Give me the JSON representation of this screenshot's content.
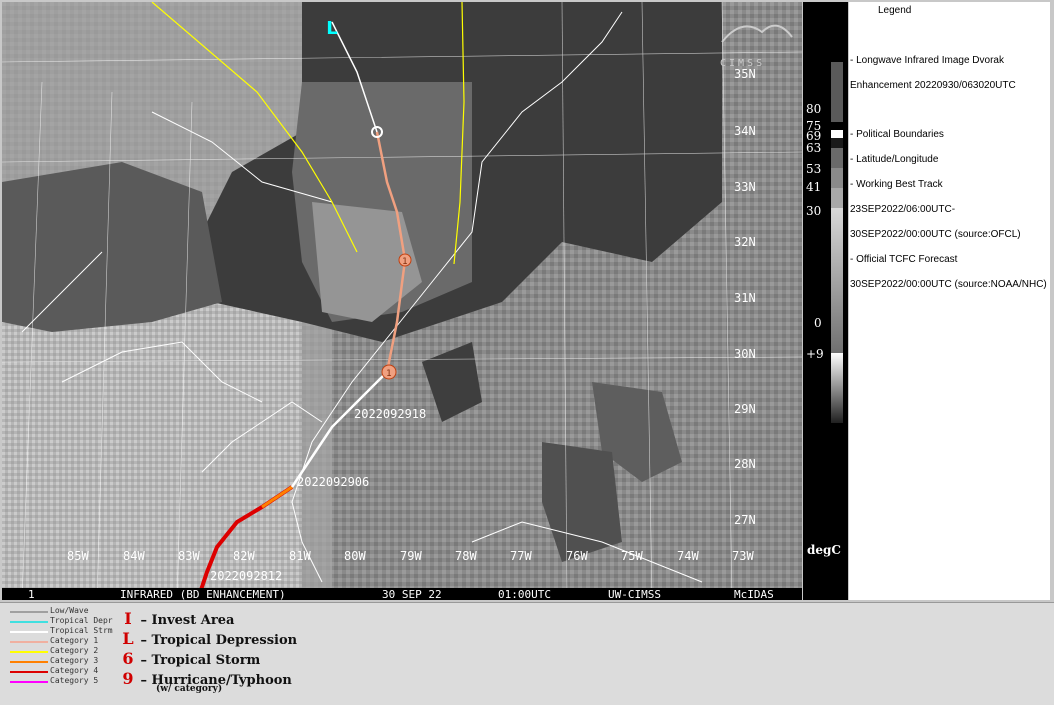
{
  "map": {
    "lon_labels": [
      "85W",
      "84W",
      "83W",
      "82W",
      "81W",
      "80W",
      "79W",
      "78W",
      "77W",
      "76W",
      "75W",
      "74W",
      "73W"
    ],
    "lat_labels": [
      "35N",
      "34N",
      "33N",
      "32N",
      "31N",
      "30N",
      "29N",
      "28N",
      "27N"
    ],
    "track_labels": [
      "2022092918",
      "2022092906",
      "2022092812"
    ],
    "forecast_markers": [
      "1",
      "1"
    ],
    "storm_markers": [
      "L"
    ],
    "status_bar": {
      "frame": "1",
      "product": "INFRARED (BD ENHANCEMENT)",
      "date": "30 SEP 22",
      "time": "01:00UTC",
      "source": "UW-CIMSS",
      "software": "McIDAS"
    },
    "logo": "CIMSS",
    "colors": {
      "observed_track": "#ffffff",
      "forecast_track": "#f0a080",
      "cone": "#ffff00",
      "category3": "#ff8000",
      "category4": "#cc0000",
      "depression_marker": "#00ffff"
    }
  },
  "colorbar": {
    "labels": [
      "80",
      "75",
      "69",
      "63",
      "53",
      "41",
      "30",
      "0",
      "+9"
    ],
    "unit": "degC"
  },
  "legend": {
    "title": "Legend",
    "lines": [
      "-  Longwave Infrared Image  Dvorak",
      "Enhancement  20220930/063020UTC",
      "-  Political Boundaries",
      "-  Latitude/Longitude",
      "-  Working Best Track",
      "23SEP2022/06:00UTC-",
      "30SEP2022/00:00UTC   (source:OFCL)",
      "-  Official TCFC Forecast",
      "30SEP2022/00:00UTC  (source:NOAA/NHC)"
    ]
  },
  "track_legend": {
    "categories": [
      {
        "label": "Low/Wave",
        "color": "#a0a0a0"
      },
      {
        "label": "Tropical Depr",
        "color": "#40e0e0"
      },
      {
        "label": "Tropical Strm",
        "color": "#ffffff"
      },
      {
        "label": "Category 1",
        "color": "#f0b0a0"
      },
      {
        "label": "Category 2",
        "color": "#ffff00"
      },
      {
        "label": "Category 3",
        "color": "#ff8000"
      },
      {
        "label": "Category 4",
        "color": "#dd0000"
      },
      {
        "label": "Category 5",
        "color": "#ff00ff"
      }
    ],
    "symbols": [
      {
        "icon": "invest-icon",
        "glyph": "I",
        "label": "– Invest Area"
      },
      {
        "icon": "depression-icon",
        "glyph": "L",
        "label": "– Tropical Depression"
      },
      {
        "icon": "storm-icon",
        "glyph": "6",
        "label": "– Tropical Storm"
      },
      {
        "icon": "hurricane-icon",
        "glyph": "9",
        "label": "– Hurricane/Typhoon"
      }
    ],
    "symbol_note": "(w/ category)"
  }
}
